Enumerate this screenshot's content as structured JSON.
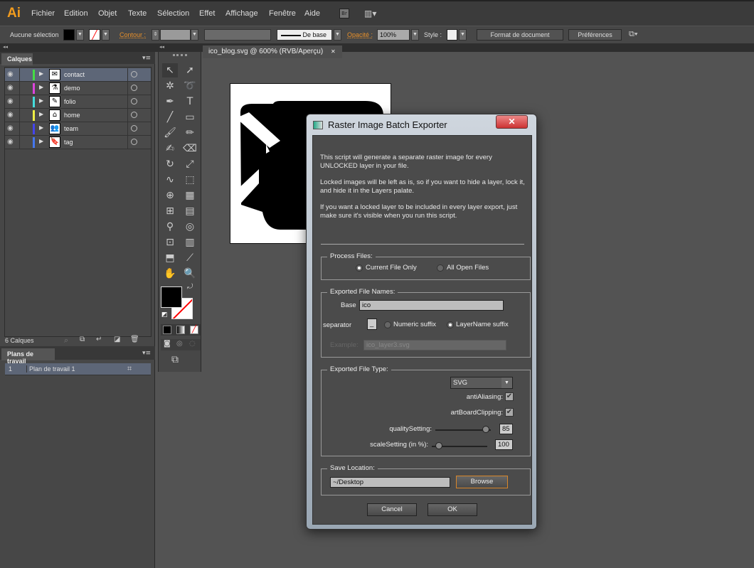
{
  "app": {
    "logo": "Ai",
    "menu": [
      "Fichier",
      "Edition",
      "Objet",
      "Texte",
      "Sélection",
      "Effet",
      "Affichage",
      "Fenêtre",
      "Aide"
    ],
    "bridge": "Br"
  },
  "control": {
    "selection": "Aucune sélection",
    "stroke_label": "Contour :",
    "brush": "De base",
    "opacity_label": "Opacité :",
    "opacity": "100%",
    "style_label": "Style :",
    "doc_format": "Format de document",
    "prefs": "Préférences"
  },
  "layers": {
    "tab": "Calques",
    "count": "6 Calques",
    "items": [
      {
        "name": "contact",
        "color": "#44dd44",
        "selected": true
      },
      {
        "name": "demo",
        "color": "#dd44dd"
      },
      {
        "name": "folio",
        "color": "#44dddd"
      },
      {
        "name": "home",
        "color": "#eeee44"
      },
      {
        "name": "team",
        "color": "#4444ee"
      },
      {
        "name": "tag",
        "color": "#4477ee"
      }
    ]
  },
  "artboards": {
    "tab": "Plans de travail",
    "items": [
      {
        "num": "1",
        "name": "Plan de travail 1"
      }
    ]
  },
  "document": {
    "tab": "ico_blog.svg @ 600% (RVB/Aperçu)"
  },
  "dialog": {
    "title": "Raster Image Batch Exporter",
    "intro": [
      "This script will generate a separate raster image for every UNLOCKED layer in your file.",
      "Locked images will be left as is, so if you want to hide a layer, lock it, and hide it in the Layers palate.",
      "If you want a locked layer to be included in every layer export, just make sure it's visible when you run this script."
    ],
    "process": {
      "legend": "Process Files:",
      "options": [
        "Current File Only",
        "All Open Files"
      ],
      "selected": 0
    },
    "names": {
      "legend": "Exported File Names:",
      "base_label": "Base",
      "base": "ico",
      "separator_label": "separator",
      "separator": "_",
      "suffix_options": [
        "Numeric suffix",
        "LayerName suffix"
      ],
      "suffix_selected": 1,
      "example_label": "Example:",
      "example": "ico_layer3.svg"
    },
    "type": {
      "legend": "Exported File Type:",
      "format": "SVG",
      "antialias_label": "antiAliasing:",
      "antialias": true,
      "clip_label": "artBoardClipping:",
      "clip": true,
      "quality_label": "qualitySetting:",
      "quality": "85",
      "scale_label": "scaleSetting (in %):",
      "scale": "100"
    },
    "save": {
      "legend": "Save Location:",
      "path": "~/Desktop",
      "browse": "Browse"
    },
    "cancel": "Cancel",
    "ok": "OK"
  }
}
